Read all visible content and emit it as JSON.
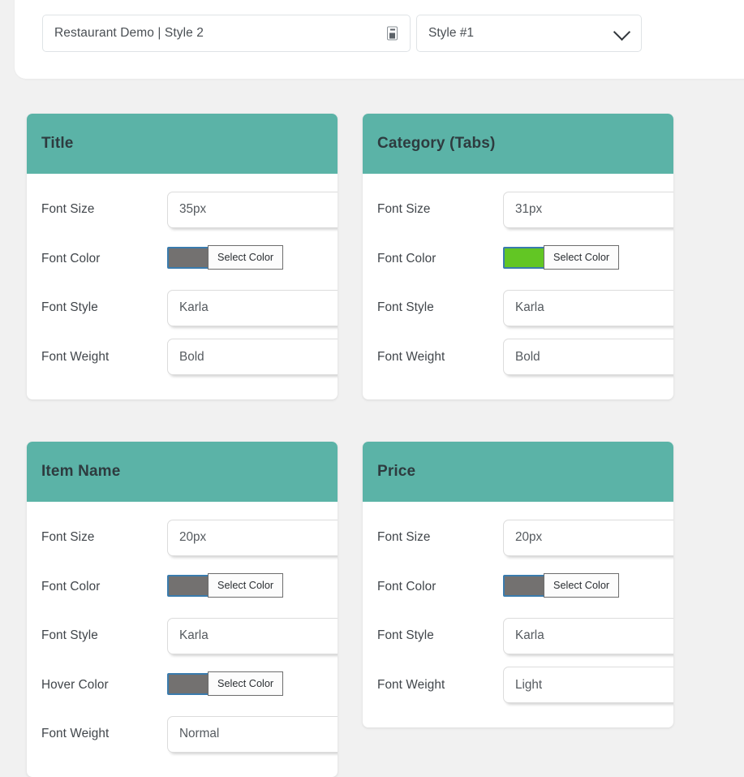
{
  "topbar": {
    "demo_select": {
      "value": "Restaurant Demo | Style 2",
      "icon": "import-template-icon"
    },
    "style_select": {
      "value": "Style #1",
      "icon": "chevron-down-icon"
    }
  },
  "colors": {
    "card_header_teal": "#5bb3a7",
    "page_background": "#f1f1f1",
    "swatch_gray": "#737170",
    "swatch_green": "#62c624",
    "focus_blue": "#3a7bad"
  },
  "cards": [
    {
      "title": "Title",
      "fields": [
        {
          "label": "Font Size",
          "type": "text",
          "value": "35px"
        },
        {
          "label": "Font Color",
          "type": "color",
          "swatch": "#737170",
          "button": "Select Color"
        },
        {
          "label": "Font Style",
          "type": "text",
          "value": "Karla"
        },
        {
          "label": "Font Weight",
          "type": "text",
          "value": "Bold"
        }
      ]
    },
    {
      "title": "Category (Tabs)",
      "fields": [
        {
          "label": "Font Size",
          "type": "text",
          "value": "31px"
        },
        {
          "label": "Font Color",
          "type": "color",
          "swatch": "#62c624",
          "button": "Select Color"
        },
        {
          "label": "Font Style",
          "type": "text",
          "value": "Karla"
        },
        {
          "label": "Font Weight",
          "type": "text",
          "value": "Bold"
        }
      ]
    },
    {
      "title": "Item Name",
      "fields": [
        {
          "label": "Font Size",
          "type": "text",
          "value": "20px"
        },
        {
          "label": "Font Color",
          "type": "color",
          "swatch": "#737170",
          "button": "Select Color"
        },
        {
          "label": "Font Style",
          "type": "text",
          "value": "Karla"
        },
        {
          "label": "Hover Color",
          "type": "color",
          "swatch": "#737170",
          "button": "Select Color"
        },
        {
          "label": "Font Weight",
          "type": "text",
          "value": "Normal"
        }
      ]
    },
    {
      "title": "Price",
      "fields": [
        {
          "label": "Font Size",
          "type": "text",
          "value": "20px"
        },
        {
          "label": "Font Color",
          "type": "color",
          "swatch": "#737170",
          "button": "Select Color"
        },
        {
          "label": "Font Style",
          "type": "text",
          "value": "Karla"
        },
        {
          "label": "Font Weight",
          "type": "text",
          "value": "Light"
        }
      ]
    }
  ]
}
